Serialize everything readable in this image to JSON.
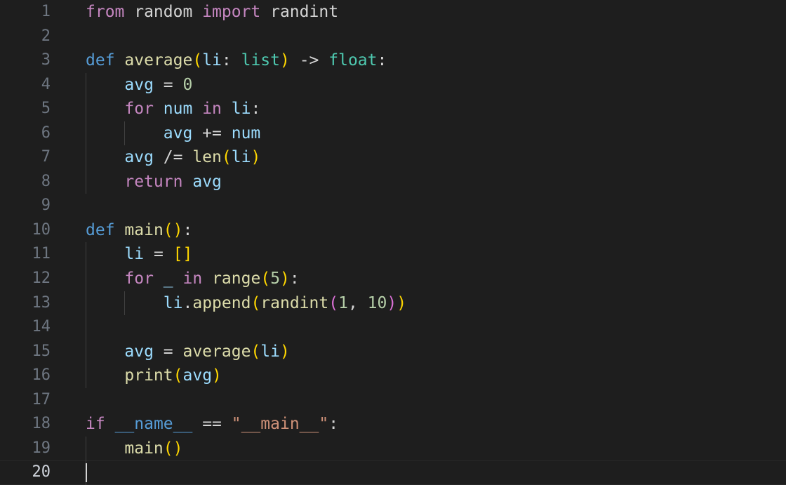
{
  "editor": {
    "language": "python",
    "theme": "dark-plus",
    "background_color": "#1e1e1e",
    "line_number_color": "#6e7681",
    "active_line_number_color": "#cfd4dc",
    "indent_guide_color": "#404040",
    "cursor_color": "#d4d4d4",
    "total_lines": 20,
    "active_line": 20,
    "cursor_line": 20,
    "cursor_column": 1,
    "font_size_px": 23,
    "line_height_px": 34.55
  },
  "colors": {
    "keyword": "#c586c0",
    "keyword_declaration": "#569cd6",
    "function": "#dcdcaa",
    "variable": "#9cdcfe",
    "type": "#4ec9b0",
    "number": "#b5cea8",
    "string": "#ce9178",
    "operator": "#d4d4d4",
    "bracket_level_0": "#ffd700",
    "bracket_level_1": "#da70d6",
    "plain": "#d4d4d4"
  },
  "lines": [
    {
      "number": "1",
      "indent_guides": [],
      "tokens": [
        {
          "text": "from",
          "cls": "t-kw"
        },
        {
          "text": " random ",
          "cls": "t-plain"
        },
        {
          "text": "import",
          "cls": "t-kw"
        },
        {
          "text": " randint",
          "cls": "t-plain"
        }
      ]
    },
    {
      "number": "2",
      "indent_guides": [],
      "tokens": []
    },
    {
      "number": "3",
      "indent_guides": [],
      "tokens": [
        {
          "text": "def",
          "cls": "t-kw2"
        },
        {
          "text": " ",
          "cls": "t-plain"
        },
        {
          "text": "average",
          "cls": "t-fn"
        },
        {
          "text": "(",
          "cls": "t-br0"
        },
        {
          "text": "li",
          "cls": "t-var"
        },
        {
          "text": ": ",
          "cls": "t-plain"
        },
        {
          "text": "list",
          "cls": "t-type"
        },
        {
          "text": ")",
          "cls": "t-br0"
        },
        {
          "text": " -> ",
          "cls": "t-op"
        },
        {
          "text": "float",
          "cls": "t-type"
        },
        {
          "text": ":",
          "cls": "t-plain"
        }
      ]
    },
    {
      "number": "4",
      "indent_guides": [
        0
      ],
      "tokens": [
        {
          "text": "    ",
          "cls": "t-plain"
        },
        {
          "text": "avg",
          "cls": "t-var"
        },
        {
          "text": " = ",
          "cls": "t-op"
        },
        {
          "text": "0",
          "cls": "t-num"
        }
      ]
    },
    {
      "number": "5",
      "indent_guides": [
        0
      ],
      "tokens": [
        {
          "text": "    ",
          "cls": "t-plain"
        },
        {
          "text": "for",
          "cls": "t-kw"
        },
        {
          "text": " ",
          "cls": "t-plain"
        },
        {
          "text": "num",
          "cls": "t-var"
        },
        {
          "text": " ",
          "cls": "t-plain"
        },
        {
          "text": "in",
          "cls": "t-kw"
        },
        {
          "text": " ",
          "cls": "t-plain"
        },
        {
          "text": "li",
          "cls": "t-var"
        },
        {
          "text": ":",
          "cls": "t-plain"
        }
      ]
    },
    {
      "number": "6",
      "indent_guides": [
        0,
        1
      ],
      "tokens": [
        {
          "text": "        ",
          "cls": "t-plain"
        },
        {
          "text": "avg",
          "cls": "t-var"
        },
        {
          "text": " += ",
          "cls": "t-op"
        },
        {
          "text": "num",
          "cls": "t-var"
        }
      ]
    },
    {
      "number": "7",
      "indent_guides": [
        0
      ],
      "tokens": [
        {
          "text": "    ",
          "cls": "t-plain"
        },
        {
          "text": "avg",
          "cls": "t-var"
        },
        {
          "text": " /= ",
          "cls": "t-op"
        },
        {
          "text": "len",
          "cls": "t-fn"
        },
        {
          "text": "(",
          "cls": "t-br0"
        },
        {
          "text": "li",
          "cls": "t-var"
        },
        {
          "text": ")",
          "cls": "t-br0"
        }
      ]
    },
    {
      "number": "8",
      "indent_guides": [
        0
      ],
      "tokens": [
        {
          "text": "    ",
          "cls": "t-plain"
        },
        {
          "text": "return",
          "cls": "t-kw"
        },
        {
          "text": " ",
          "cls": "t-plain"
        },
        {
          "text": "avg",
          "cls": "t-var"
        }
      ]
    },
    {
      "number": "9",
      "indent_guides": [],
      "tokens": []
    },
    {
      "number": "10",
      "indent_guides": [],
      "tokens": [
        {
          "text": "def",
          "cls": "t-kw2"
        },
        {
          "text": " ",
          "cls": "t-plain"
        },
        {
          "text": "main",
          "cls": "t-fn"
        },
        {
          "text": "(",
          "cls": "t-br0"
        },
        {
          "text": ")",
          "cls": "t-br0"
        },
        {
          "text": ":",
          "cls": "t-plain"
        }
      ]
    },
    {
      "number": "11",
      "indent_guides": [
        0
      ],
      "tokens": [
        {
          "text": "    ",
          "cls": "t-plain"
        },
        {
          "text": "li",
          "cls": "t-var"
        },
        {
          "text": " = ",
          "cls": "t-op"
        },
        {
          "text": "[",
          "cls": "t-br0"
        },
        {
          "text": "]",
          "cls": "t-br0"
        }
      ]
    },
    {
      "number": "12",
      "indent_guides": [
        0
      ],
      "tokens": [
        {
          "text": "    ",
          "cls": "t-plain"
        },
        {
          "text": "for",
          "cls": "t-kw"
        },
        {
          "text": " ",
          "cls": "t-plain"
        },
        {
          "text": "_",
          "cls": "t-var"
        },
        {
          "text": " ",
          "cls": "t-plain"
        },
        {
          "text": "in",
          "cls": "t-kw"
        },
        {
          "text": " ",
          "cls": "t-plain"
        },
        {
          "text": "range",
          "cls": "t-fn"
        },
        {
          "text": "(",
          "cls": "t-br0"
        },
        {
          "text": "5",
          "cls": "t-num"
        },
        {
          "text": ")",
          "cls": "t-br0"
        },
        {
          "text": ":",
          "cls": "t-plain"
        }
      ]
    },
    {
      "number": "13",
      "indent_guides": [
        0,
        1
      ],
      "tokens": [
        {
          "text": "        ",
          "cls": "t-plain"
        },
        {
          "text": "li",
          "cls": "t-var"
        },
        {
          "text": ".",
          "cls": "t-plain"
        },
        {
          "text": "append",
          "cls": "t-fn"
        },
        {
          "text": "(",
          "cls": "t-br0"
        },
        {
          "text": "randint",
          "cls": "t-fn"
        },
        {
          "text": "(",
          "cls": "t-br1"
        },
        {
          "text": "1",
          "cls": "t-num"
        },
        {
          "text": ", ",
          "cls": "t-plain"
        },
        {
          "text": "10",
          "cls": "t-num"
        },
        {
          "text": ")",
          "cls": "t-br1"
        },
        {
          "text": ")",
          "cls": "t-br0"
        }
      ]
    },
    {
      "number": "14",
      "indent_guides": [
        0
      ],
      "tokens": []
    },
    {
      "number": "15",
      "indent_guides": [
        0
      ],
      "tokens": [
        {
          "text": "    ",
          "cls": "t-plain"
        },
        {
          "text": "avg",
          "cls": "t-var"
        },
        {
          "text": " = ",
          "cls": "t-op"
        },
        {
          "text": "average",
          "cls": "t-fn"
        },
        {
          "text": "(",
          "cls": "t-br0"
        },
        {
          "text": "li",
          "cls": "t-var"
        },
        {
          "text": ")",
          "cls": "t-br0"
        }
      ]
    },
    {
      "number": "16",
      "indent_guides": [
        0
      ],
      "tokens": [
        {
          "text": "    ",
          "cls": "t-plain"
        },
        {
          "text": "print",
          "cls": "t-fn"
        },
        {
          "text": "(",
          "cls": "t-br0"
        },
        {
          "text": "avg",
          "cls": "t-var"
        },
        {
          "text": ")",
          "cls": "t-br0"
        }
      ]
    },
    {
      "number": "17",
      "indent_guides": [],
      "tokens": []
    },
    {
      "number": "18",
      "indent_guides": [],
      "tokens": [
        {
          "text": "if",
          "cls": "t-kw"
        },
        {
          "text": " ",
          "cls": "t-plain"
        },
        {
          "text": "__name__",
          "cls": "t-kw2"
        },
        {
          "text": " == ",
          "cls": "t-op"
        },
        {
          "text": "\"__main__\"",
          "cls": "t-str"
        },
        {
          "text": ":",
          "cls": "t-plain"
        }
      ]
    },
    {
      "number": "19",
      "indent_guides": [
        0
      ],
      "tokens": [
        {
          "text": "    ",
          "cls": "t-plain"
        },
        {
          "text": "main",
          "cls": "t-fn"
        },
        {
          "text": "(",
          "cls": "t-br0"
        },
        {
          "text": ")",
          "cls": "t-br0"
        }
      ]
    },
    {
      "number": "20",
      "indent_guides": [
        0
      ],
      "active": true,
      "cursor": true,
      "tokens": []
    }
  ],
  "source_text": "from random import randint\n\ndef average(li: list) -> float:\n    avg = 0\n    for num in li:\n        avg += num\n    avg /= len(li)\n    return avg\n\ndef main():\n    li = []\n    for _ in range(5):\n        li.append(randint(1, 10))\n\n    avg = average(li)\n    print(avg)\n\nif __name__ == \"__main__\":\n    main()\n"
}
